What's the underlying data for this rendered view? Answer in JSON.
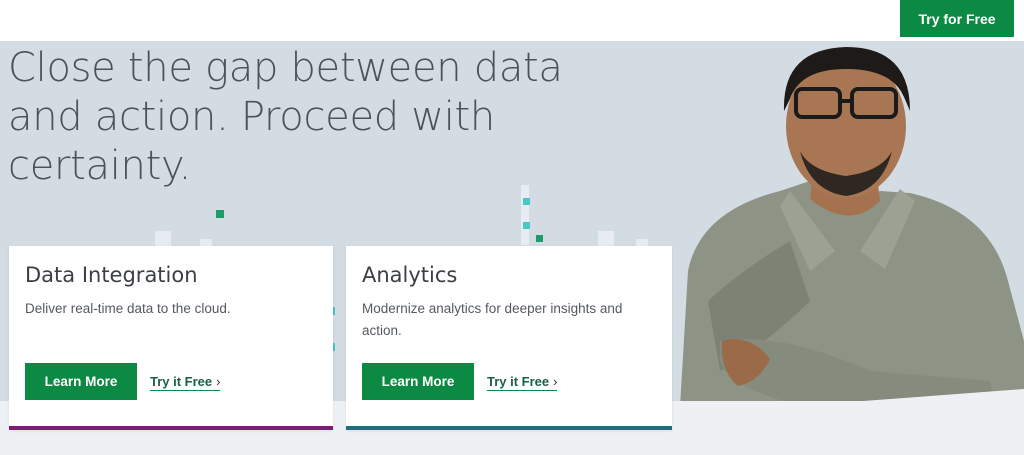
{
  "header": {
    "cta_label": "Try for Free"
  },
  "hero": {
    "headline": "Close the gap between data and action. Proceed with certainty."
  },
  "cards": [
    {
      "title": "Data Integration",
      "description": "Deliver real-time data to the cloud.",
      "primary_label": "Learn More",
      "secondary_label": "Try it Free",
      "accent_color": "#7b1d72"
    },
    {
      "title": "Analytics",
      "description": "Modernize analytics for deeper insights and action.",
      "primary_label": "Learn More",
      "secondary_label": "Try it Free",
      "accent_color": "#1f6d7d"
    }
  ],
  "colors": {
    "brand_green": "#0c8a43",
    "hero_background": "#d4dce3"
  },
  "icons": {
    "link_arrow": "chevron-right-icon"
  }
}
